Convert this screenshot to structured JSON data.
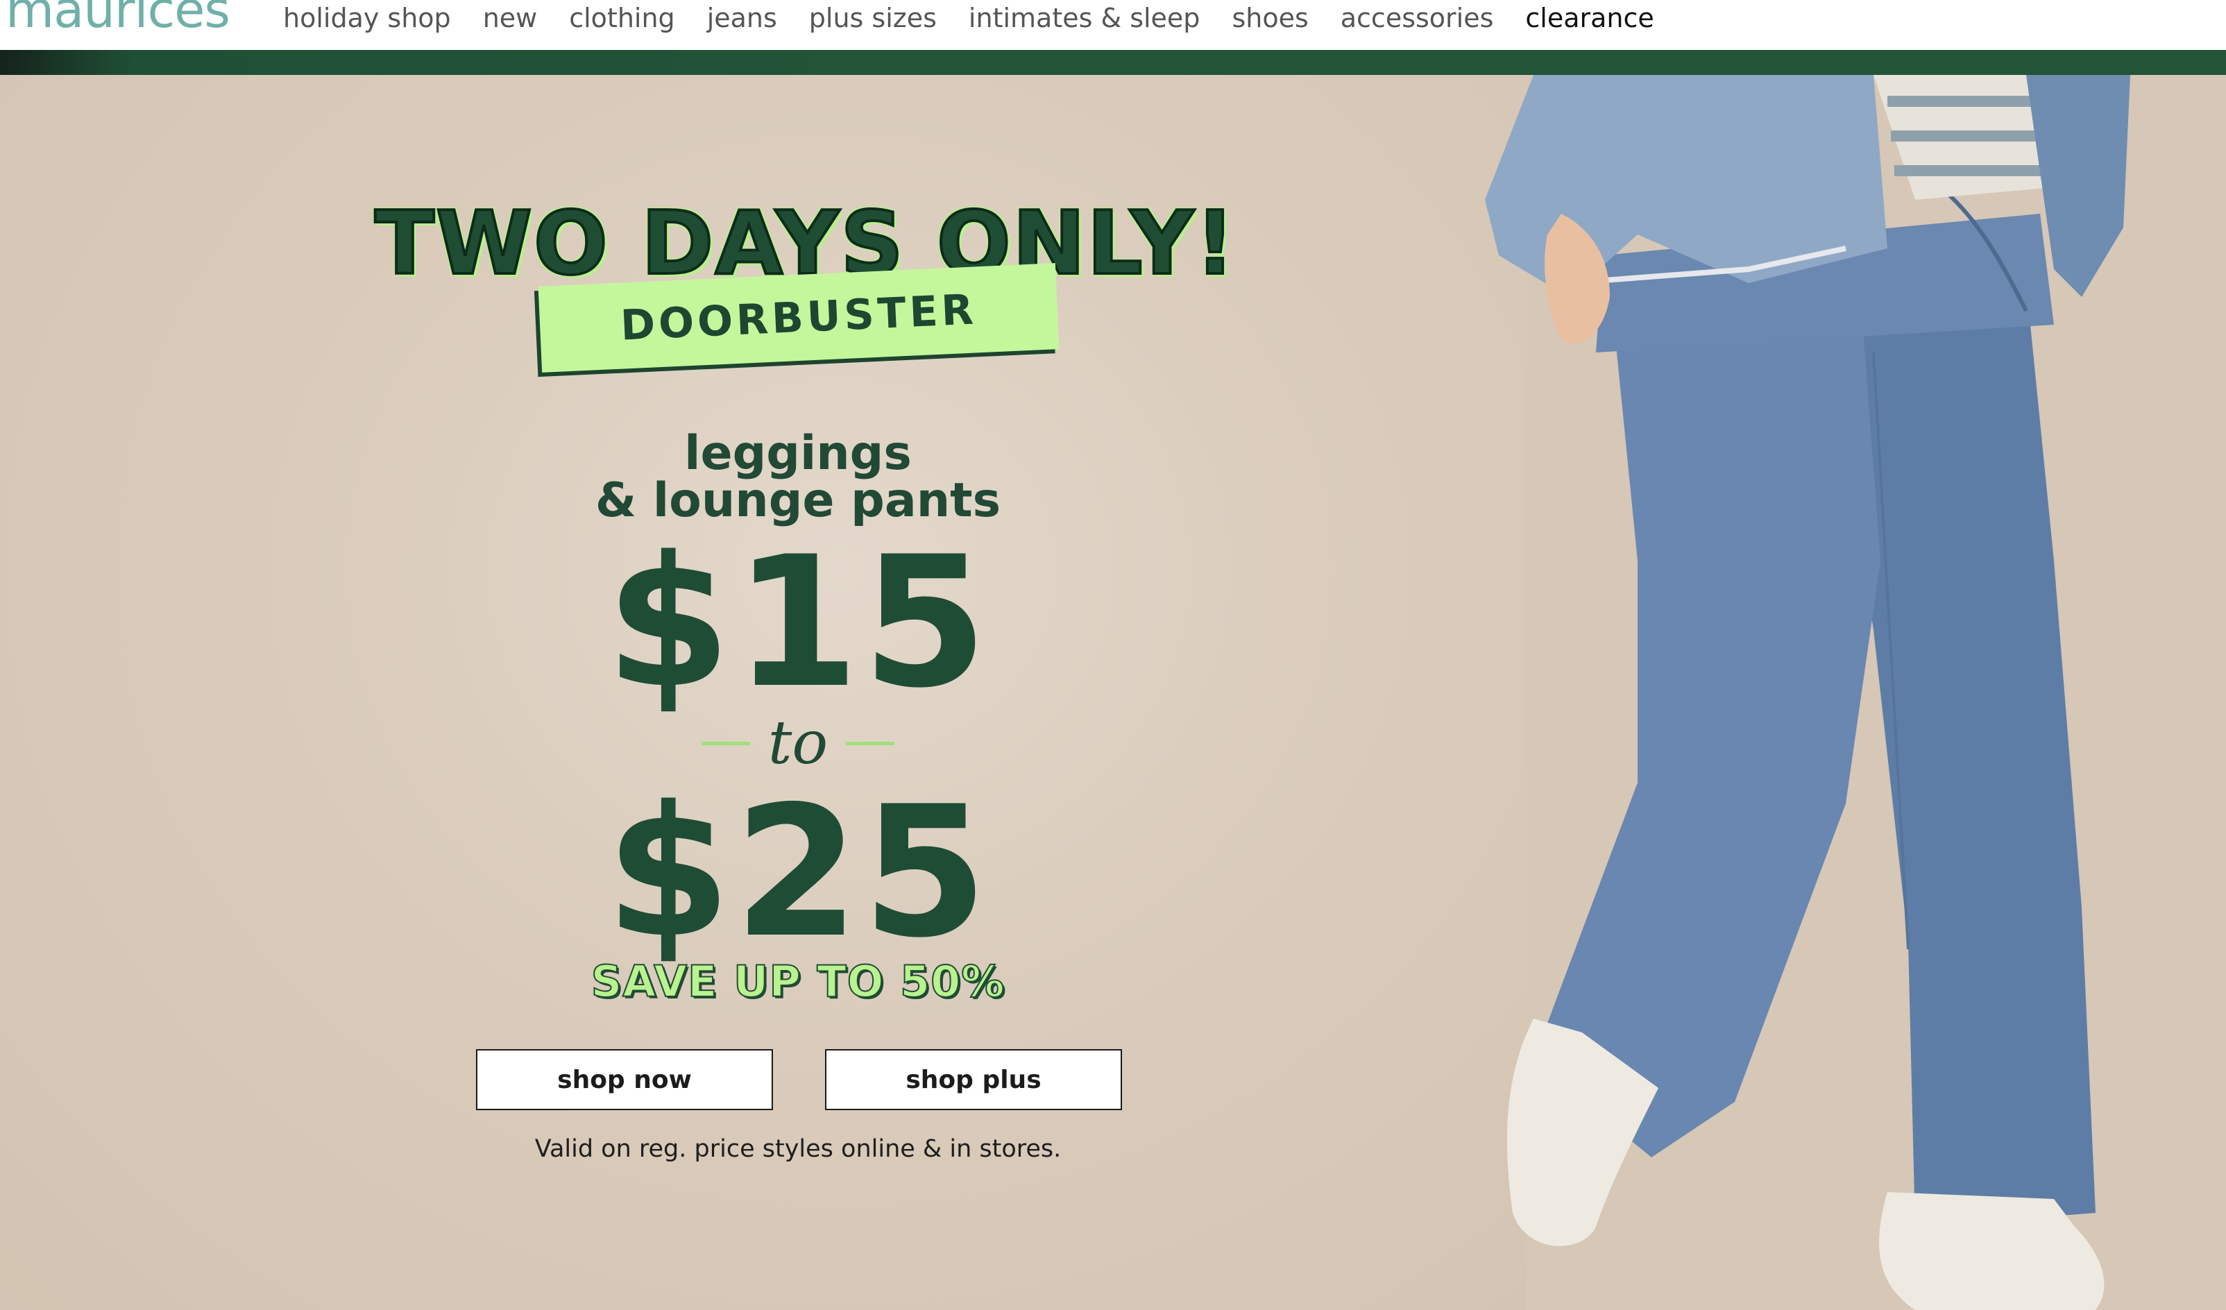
{
  "brand": {
    "logo_text": "maurices",
    "logo_color": "#6fb0a8"
  },
  "nav": {
    "items": [
      {
        "label": "holiday shop"
      },
      {
        "label": "new"
      },
      {
        "label": "clothing"
      },
      {
        "label": "jeans"
      },
      {
        "label": "plus sizes"
      },
      {
        "label": "intimates & sleep"
      },
      {
        "label": "shoes"
      },
      {
        "label": "accessories"
      },
      {
        "label": "clearance"
      }
    ]
  },
  "colors": {
    "accent_bar": "#225438",
    "hero_background": "#d6c7b7",
    "headline_green": "#1f4d34",
    "lime": "#c4f79c"
  },
  "promo": {
    "headline": "TWO DAYS ONLY!",
    "tag": "DOORBUSTER",
    "subtitle_line1": "leggings",
    "subtitle_line2": "& lounge pants",
    "price_low": "$15",
    "connector": "to",
    "price_high": "$25",
    "savings": "SAVE UP TO 50%",
    "disclaimer": "Valid on reg. price styles online & in stores."
  },
  "buttons": {
    "shop_now": "shop now",
    "shop_plus": "shop plus"
  }
}
